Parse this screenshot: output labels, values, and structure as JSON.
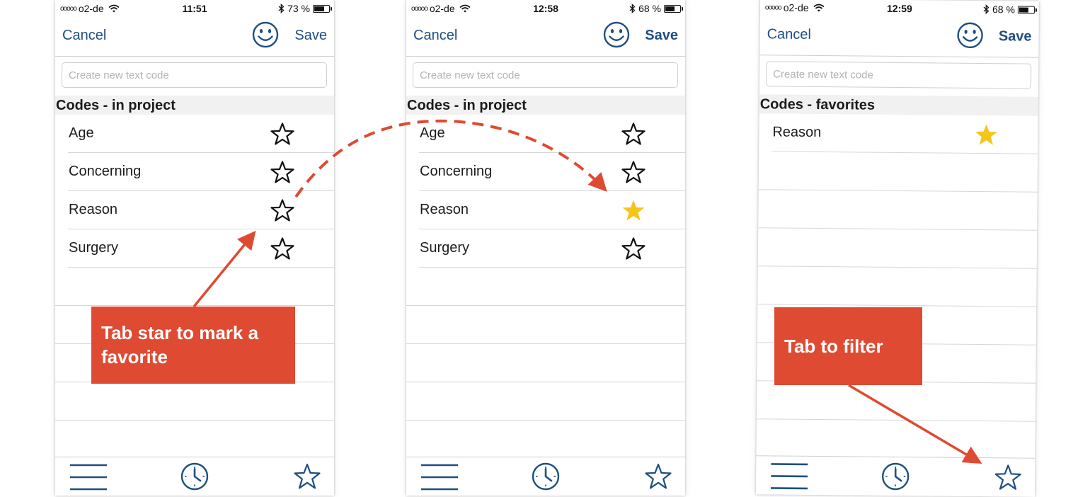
{
  "colors": {
    "accent": "#1d4f82",
    "star_filled": "#f5c518",
    "callout": "#df4a32"
  },
  "phones": [
    {
      "status": {
        "signal": "ooooo",
        "carrier": "o2-de",
        "time": "11:51",
        "battery": "73 %",
        "battery_level": 73
      },
      "nav": {
        "cancel": "Cancel",
        "save": "Save"
      },
      "input_placeholder": "Create new text code",
      "section": "Codes - in project",
      "codes": [
        {
          "label": "Age",
          "favorite": false
        },
        {
          "label": "Concerning",
          "favorite": false
        },
        {
          "label": "Reason",
          "favorite": false
        },
        {
          "label": "Surgery",
          "favorite": false
        }
      ]
    },
    {
      "status": {
        "signal": "ooooo",
        "carrier": "o2-de",
        "time": "12:58",
        "battery": "68 %",
        "battery_level": 68
      },
      "nav": {
        "cancel": "Cancel",
        "save": "Save"
      },
      "input_placeholder": "Create new text code",
      "section": "Codes - in project",
      "codes": [
        {
          "label": "Age",
          "favorite": false
        },
        {
          "label": "Concerning",
          "favorite": false
        },
        {
          "label": "Reason",
          "favorite": true
        },
        {
          "label": "Surgery",
          "favorite": false
        }
      ]
    },
    {
      "status": {
        "signal": "ooooo",
        "carrier": "o2-de",
        "time": "12:59",
        "battery": "68 %",
        "battery_level": 68
      },
      "nav": {
        "cancel": "Cancel",
        "save": "Save"
      },
      "input_placeholder": "Create new text code",
      "section": "Codes - favorites",
      "codes": [
        {
          "label": "Reason",
          "favorite": true
        }
      ]
    }
  ],
  "icons": {
    "nav": [
      "smiley-icon"
    ],
    "status": [
      "wifi-icon",
      "bluetooth-icon",
      "battery-icon"
    ],
    "tabs": [
      "menu-icon",
      "clock-icon",
      "star-icon"
    ]
  },
  "callouts": {
    "mark_favorite": "Tab star to mark a favorite",
    "filter": "Tab to filter"
  }
}
